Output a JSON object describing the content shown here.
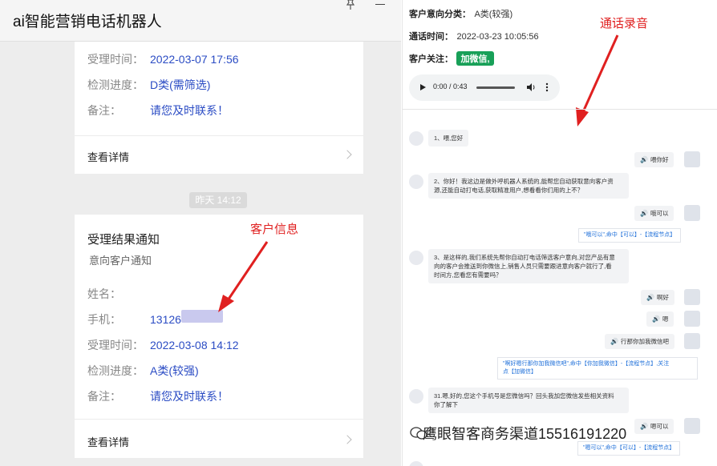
{
  "app": {
    "title": "ai智能营销电话机器人"
  },
  "left": {
    "card1": {
      "rows": [
        {
          "label": "受理时间：",
          "value": "2022-03-07 17:56"
        },
        {
          "label": "检测进度：",
          "value": "D类(需筛选)"
        },
        {
          "label": "备注：",
          "value": "请您及时联系！"
        }
      ],
      "detail_label": "查看详情"
    },
    "time_separator": "昨天  14:12",
    "card2": {
      "title": "受理结果通知",
      "subtitle": "意向客户通知",
      "rows": [
        {
          "label": "姓名：",
          "value": ""
        },
        {
          "label": "手机：",
          "value": "13126"
        },
        {
          "label": "受理时间：",
          "value": "2022-03-08 14:12"
        },
        {
          "label": "检测进度：",
          "value": "A类(较强)"
        },
        {
          "label": "备注：",
          "value": "请您及时联系！"
        }
      ],
      "detail_label": "查看详情"
    },
    "annotation": "客户信息"
  },
  "right": {
    "intent_label": "客户意向分类：",
    "intent_value": "A类(较强)",
    "call_time_label": "通话时间：",
    "call_time_value": "2022-03-23 10:05:56",
    "focus_label": "客户关注：",
    "focus_tag": "加微信,",
    "audio_time": "0:00 / 0:43",
    "annotation": "通话录音",
    "messages": {
      "m1": "1、喂,您好",
      "r1": "喂你好",
      "m2a": "2、你好！我这边是做外呼机器人系统的,能帮您自动获取意向客户资",
      "m2b": "源,还能自动打电话,获取精准用户,想看看你们用的上不？",
      "r2": "哦可以",
      "n1": "\"哦可以\",命中【可以】-【流程节点】",
      "m3a": "3、是这样的,我们系统先帮你自动打电话筛选客户意向,对您产品有意",
      "m3b": "向的客户会推送到你微信上,销售人员只需要跟进意向客户就行了,看",
      "m3c": "时间方,您看您有需要吗？",
      "r3": "啊好",
      "r4": "嗯",
      "r5": "行那你加我微信吧",
      "n2a": "\"啊好嗯行那你加我微信吧\",命中【你加我微信】-【流程节点】,关注",
      "n2b": "点【加微信】",
      "m4a": "31.嗯,好的,您这个手机号是您微信吗？回头我加您微信发些相关资料",
      "m4b": "你了解下",
      "r6": "嗯可以",
      "n3": "\"嗯可以\",命中【可以】-【流程节点】"
    }
  },
  "watermark": "鹰眼智客商务渠道15516191220"
}
